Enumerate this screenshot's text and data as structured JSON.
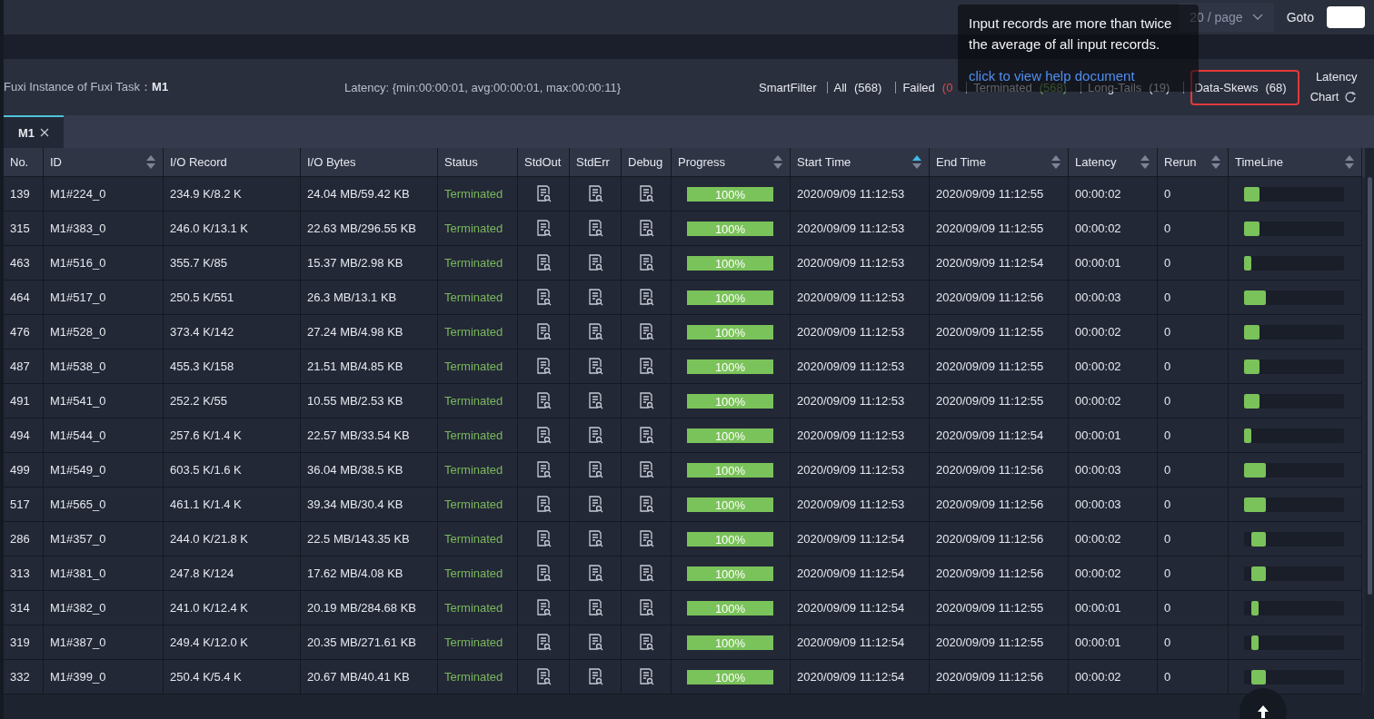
{
  "pager": {
    "page_size": "20 / page",
    "goto_label": "Goto"
  },
  "header": {
    "title": "Fuxi Instance of Fuxi Task：",
    "task": "M1",
    "latency": "Latency: {min:00:00:01, avg:00:00:01, max:00:00:11}"
  },
  "smart_filter": {
    "label": "SmartFilter",
    "filters": [
      {
        "label": "All",
        "count": "(568)",
        "kind": "plain",
        "selected": false
      },
      {
        "label": "Failed",
        "count": "(0",
        "kind": "failed",
        "selected": false
      },
      {
        "label": "Terminated",
        "count": "(568)",
        "kind": "terminated",
        "selected": false
      },
      {
        "label": "Long-Tails",
        "count": "(19)",
        "kind": "plain",
        "selected": false
      },
      {
        "label": "Data-Skews",
        "count": "(68)",
        "kind": "plain",
        "selected": true
      }
    ],
    "chart_link": [
      "Latency",
      "Chart"
    ]
  },
  "tooltip": {
    "text": "Input records are more than twice the average of all input records.",
    "link": "click to view help document"
  },
  "tabs": [
    {
      "label": "M1",
      "selected": true
    }
  ],
  "table": {
    "columns": [
      {
        "label": "No.",
        "sortable": false
      },
      {
        "label": "ID",
        "sortable": true,
        "sorted": false
      },
      {
        "label": "I/O Record",
        "sortable": false
      },
      {
        "label": "I/O Bytes",
        "sortable": false
      },
      {
        "label": "Status",
        "sortable": false
      },
      {
        "label": "StdOut",
        "sortable": false
      },
      {
        "label": "StdErr",
        "sortable": false
      },
      {
        "label": "Debug",
        "sortable": false
      },
      {
        "label": "Progress",
        "sortable": true,
        "sorted": false
      },
      {
        "label": "Start Time",
        "sortable": true,
        "sorted": true
      },
      {
        "label": "End Time",
        "sortable": true,
        "sorted": false
      },
      {
        "label": "Latency",
        "sortable": true,
        "sorted": false
      },
      {
        "label": "Rerun",
        "sortable": true,
        "sorted": false
      },
      {
        "label": "TimeLine",
        "sortable": true,
        "sorted": false
      }
    ],
    "rows": [
      {
        "no": "139",
        "id": "M1#224_0",
        "io_record": "234.9 K/8.2 K",
        "io_bytes": "24.04 MB/59.42 KB",
        "status": "Terminated",
        "progress": {
          "label": "100%",
          "level": 1
        },
        "start": "2020/09/09 11:12:53",
        "end": "2020/09/09 11:12:55",
        "latency": "00:00:02",
        "rerun": "0",
        "timeline": {
          "late_start": false,
          "level": 0.15
        }
      },
      {
        "no": "315",
        "id": "M1#383_0",
        "io_record": "246.0 K/13.1 K",
        "io_bytes": "22.63 MB/296.55 KB",
        "status": "Terminated",
        "progress": {
          "label": "100%",
          "level": 1
        },
        "start": "2020/09/09 11:12:53",
        "end": "2020/09/09 11:12:55",
        "latency": "00:00:02",
        "rerun": "0",
        "timeline": {
          "late_start": false,
          "level": 0.15
        }
      },
      {
        "no": "463",
        "id": "M1#516_0",
        "io_record": "355.7 K/85",
        "io_bytes": "15.37 MB/2.98 KB",
        "status": "Terminated",
        "progress": {
          "label": "100%",
          "level": 1
        },
        "start": "2020/09/09 11:12:53",
        "end": "2020/09/09 11:12:54",
        "latency": "00:00:01",
        "rerun": "0",
        "timeline": {
          "late_start": false,
          "level": 0.07
        }
      },
      {
        "no": "464",
        "id": "M1#517_0",
        "io_record": "250.5 K/551",
        "io_bytes": "26.3 MB/13.1 KB",
        "status": "Terminated",
        "progress": {
          "label": "100%",
          "level": 1
        },
        "start": "2020/09/09 11:12:53",
        "end": "2020/09/09 11:12:56",
        "latency": "00:00:03",
        "rerun": "0",
        "timeline": {
          "late_start": false,
          "level": 0.22
        }
      },
      {
        "no": "476",
        "id": "M1#528_0",
        "io_record": "373.4 K/142",
        "io_bytes": "27.24 MB/4.98 KB",
        "status": "Terminated",
        "progress": {
          "label": "100%",
          "level": 1
        },
        "start": "2020/09/09 11:12:53",
        "end": "2020/09/09 11:12:55",
        "latency": "00:00:02",
        "rerun": "0",
        "timeline": {
          "late_start": false,
          "level": 0.15
        }
      },
      {
        "no": "487",
        "id": "M1#538_0",
        "io_record": "455.3 K/158",
        "io_bytes": "21.51 MB/4.85 KB",
        "status": "Terminated",
        "progress": {
          "label": "100%",
          "level": 1
        },
        "start": "2020/09/09 11:12:53",
        "end": "2020/09/09 11:12:55",
        "latency": "00:00:02",
        "rerun": "0",
        "timeline": {
          "late_start": false,
          "level": 0.15
        }
      },
      {
        "no": "491",
        "id": "M1#541_0",
        "io_record": "252.2 K/55",
        "io_bytes": "10.55 MB/2.53 KB",
        "status": "Terminated",
        "progress": {
          "label": "100%",
          "level": 1
        },
        "start": "2020/09/09 11:12:53",
        "end": "2020/09/09 11:12:55",
        "latency": "00:00:02",
        "rerun": "0",
        "timeline": {
          "late_start": false,
          "level": 0.15
        }
      },
      {
        "no": "494",
        "id": "M1#544_0",
        "io_record": "257.6 K/1.4 K",
        "io_bytes": "22.57 MB/33.54 KB",
        "status": "Terminated",
        "progress": {
          "label": "100%",
          "level": 1
        },
        "start": "2020/09/09 11:12:53",
        "end": "2020/09/09 11:12:54",
        "latency": "00:00:01",
        "rerun": "0",
        "timeline": {
          "late_start": false,
          "level": 0.07
        }
      },
      {
        "no": "499",
        "id": "M1#549_0",
        "io_record": "603.5 K/1.6 K",
        "io_bytes": "36.04 MB/38.5 KB",
        "status": "Terminated",
        "progress": {
          "label": "100%",
          "level": 1
        },
        "start": "2020/09/09 11:12:53",
        "end": "2020/09/09 11:12:56",
        "latency": "00:00:03",
        "rerun": "0",
        "timeline": {
          "late_start": false,
          "level": 0.22
        }
      },
      {
        "no": "517",
        "id": "M1#565_0",
        "io_record": "461.1 K/1.4 K",
        "io_bytes": "39.34 MB/30.4 KB",
        "status": "Terminated",
        "progress": {
          "label": "100%",
          "level": 1
        },
        "start": "2020/09/09 11:12:53",
        "end": "2020/09/09 11:12:56",
        "latency": "00:00:03",
        "rerun": "0",
        "timeline": {
          "late_start": false,
          "level": 0.22
        }
      },
      {
        "no": "286",
        "id": "M1#357_0",
        "io_record": "244.0 K/21.8 K",
        "io_bytes": "22.5 MB/143.35 KB",
        "status": "Terminated",
        "progress": {
          "label": "100%",
          "level": 1
        },
        "start": "2020/09/09 11:12:54",
        "end": "2020/09/09 11:12:56",
        "latency": "00:00:02",
        "rerun": "0",
        "timeline": {
          "late_start": true,
          "level": 0.15
        }
      },
      {
        "no": "313",
        "id": "M1#381_0",
        "io_record": "247.8 K/124",
        "io_bytes": "17.62 MB/4.08 KB",
        "status": "Terminated",
        "progress": {
          "label": "100%",
          "level": 1
        },
        "start": "2020/09/09 11:12:54",
        "end": "2020/09/09 11:12:56",
        "latency": "00:00:02",
        "rerun": "0",
        "timeline": {
          "late_start": true,
          "level": 0.15
        }
      },
      {
        "no": "314",
        "id": "M1#382_0",
        "io_record": "241.0 K/12.4 K",
        "io_bytes": "20.19 MB/284.68 KB",
        "status": "Terminated",
        "progress": {
          "label": "100%",
          "level": 1
        },
        "start": "2020/09/09 11:12:54",
        "end": "2020/09/09 11:12:55",
        "latency": "00:00:01",
        "rerun": "0",
        "timeline": {
          "late_start": true,
          "level": 0.08
        }
      },
      {
        "no": "319",
        "id": "M1#387_0",
        "io_record": "249.4 K/12.0 K",
        "io_bytes": "20.35 MB/271.61 KB",
        "status": "Terminated",
        "progress": {
          "label": "100%",
          "level": 1
        },
        "start": "2020/09/09 11:12:54",
        "end": "2020/09/09 11:12:55",
        "latency": "00:00:01",
        "rerun": "0",
        "timeline": {
          "late_start": true,
          "level": 0.08
        }
      },
      {
        "no": "332",
        "id": "M1#399_0",
        "io_record": "250.4 K/5.4 K",
        "io_bytes": "20.67 MB/40.41 KB",
        "status": "Terminated",
        "progress": {
          "label": "100%",
          "level": 1
        },
        "start": "2020/09/09 11:12:54",
        "end": "2020/09/09 11:12:56",
        "latency": "00:00:02",
        "rerun": "0",
        "timeline": {
          "late_start": true,
          "level": 0.15
        }
      }
    ]
  }
}
